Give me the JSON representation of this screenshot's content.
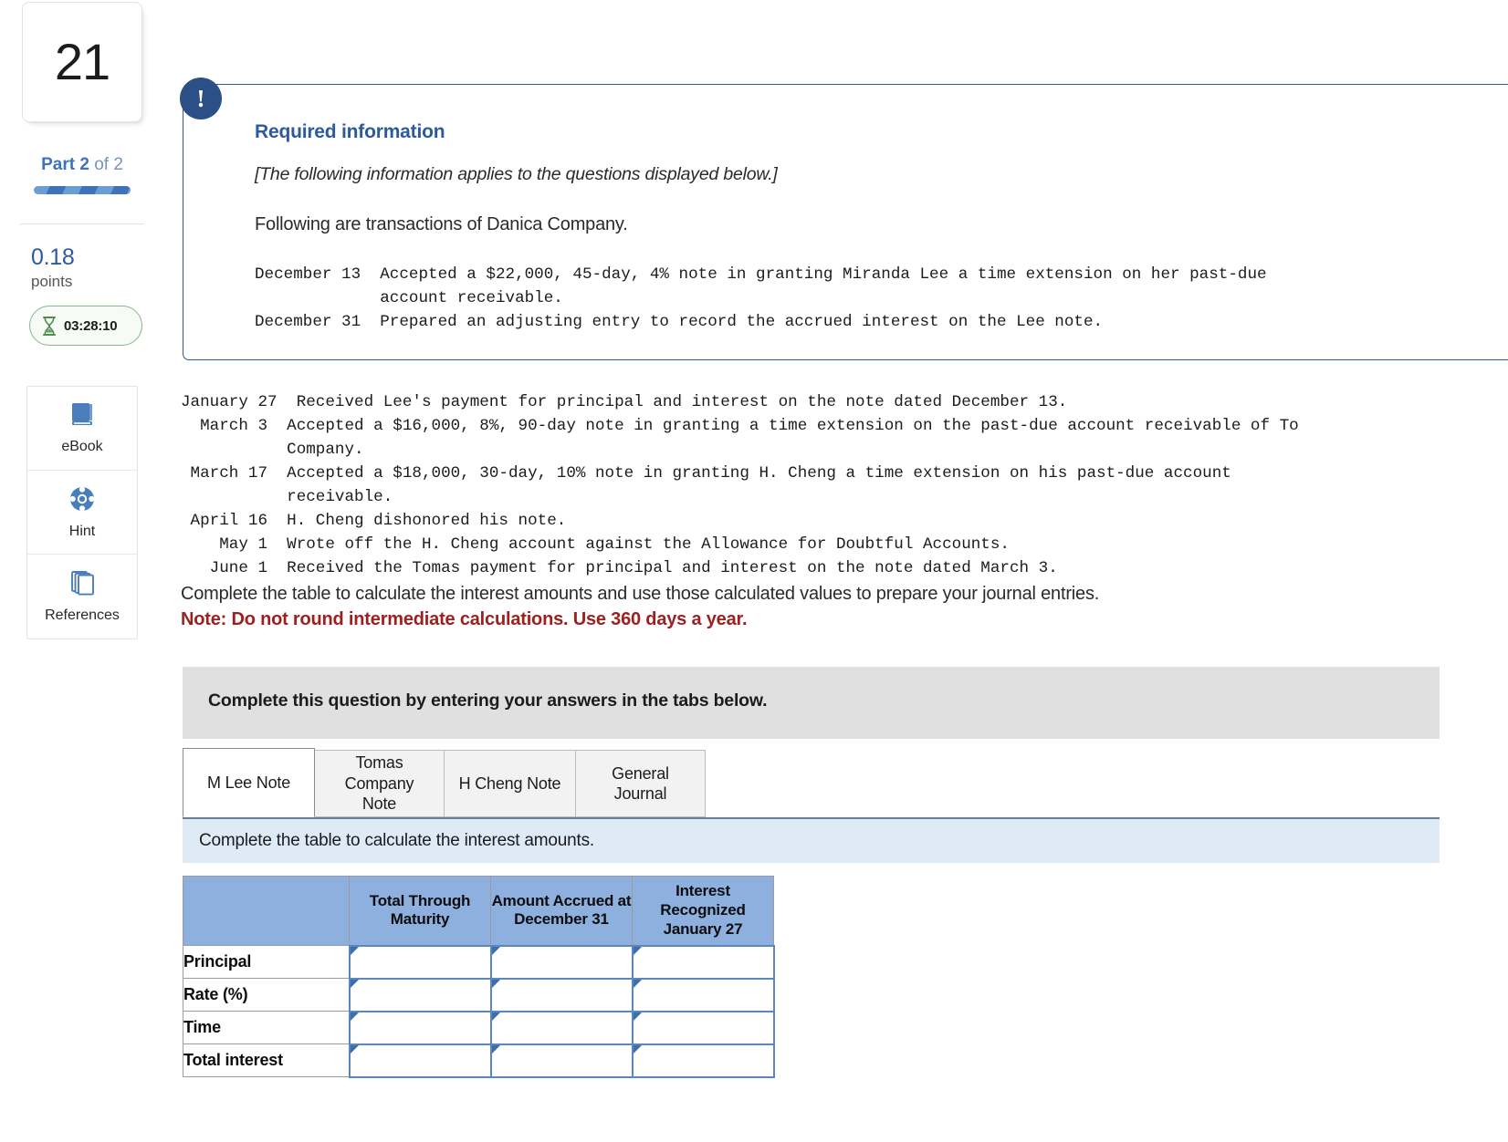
{
  "sidebar": {
    "question_number": "21",
    "part_prefix": "Part",
    "part_current": "2",
    "part_of": "of 2",
    "points_value": "0.18",
    "points_label": "points",
    "timer": "03:28:10",
    "tools": [
      {
        "label": "eBook",
        "icon": "book-icon"
      },
      {
        "label": "Hint",
        "icon": "lifebuoy-icon"
      },
      {
        "label": "References",
        "icon": "pages-stack-icon"
      }
    ]
  },
  "callout": {
    "badge": "!",
    "title": "Required information",
    "applies_note": "[The following information applies to the questions displayed below.]",
    "lead": "Following are transactions of Danica Company.",
    "transactions_top": "December 13  Accepted a $22,000, 45-day, 4% note in granting Miranda Lee a time extension on her past-due\n             account receivable.\nDecember 31  Prepared an adjusting entry to record the accrued interest on the Lee note."
  },
  "transactions_rest": "January 27  Received Lee's payment for principal and interest on the note dated December 13.\n  March 3  Accepted a $16,000, 8%, 90-day note in granting a time extension on the past-due account receivable of To\n           Company.\n March 17  Accepted a $18,000, 30-day, 10% note in granting H. Cheng a time extension on his past-due account\n           receivable.\n April 16  H. Cheng dishonored his note.\n    May 1  Wrote off the H. Cheng account against the Allowance for Doubtful Accounts.\n   June 1  Received the Tomas payment for principal and interest on the note dated March 3.",
  "instructions": {
    "line1": "Complete the table to calculate the interest amounts and use those calculated values to prepare your journal entries.",
    "note": "Note: Do not round intermediate calculations. Use 360 days a year.",
    "gray_banner": "Complete this question by entering your answers in the tabs below."
  },
  "tabs": [
    {
      "label": "M Lee Note",
      "active": true
    },
    {
      "label": "Tomas Company Note",
      "active": false
    },
    {
      "label": "H Cheng Note",
      "active": false
    },
    {
      "label": "General Journal",
      "active": false
    }
  ],
  "sub_instruction": "Complete the table to calculate the interest amounts.",
  "answer_table": {
    "columns": [
      "",
      "Total Through Maturity",
      "Amount Accrued at December 31",
      "Interest Recognized January 27"
    ],
    "rows": [
      {
        "label": "Principal",
        "values": [
          "",
          "",
          ""
        ]
      },
      {
        "label": "Rate (%)",
        "values": [
          "",
          "",
          ""
        ]
      },
      {
        "label": "Time",
        "values": [
          "",
          "",
          ""
        ]
      },
      {
        "label": "Total interest",
        "values": [
          "",
          "",
          ""
        ]
      }
    ]
  },
  "colors": {
    "accent_blue": "#2d5a9e",
    "badge_navy": "#2b4f86",
    "note_red": "#9d2020",
    "table_header_blue": "#8eb0de",
    "subinstr_blue": "#deeaf6",
    "timer_green": "#4f8a4f"
  }
}
